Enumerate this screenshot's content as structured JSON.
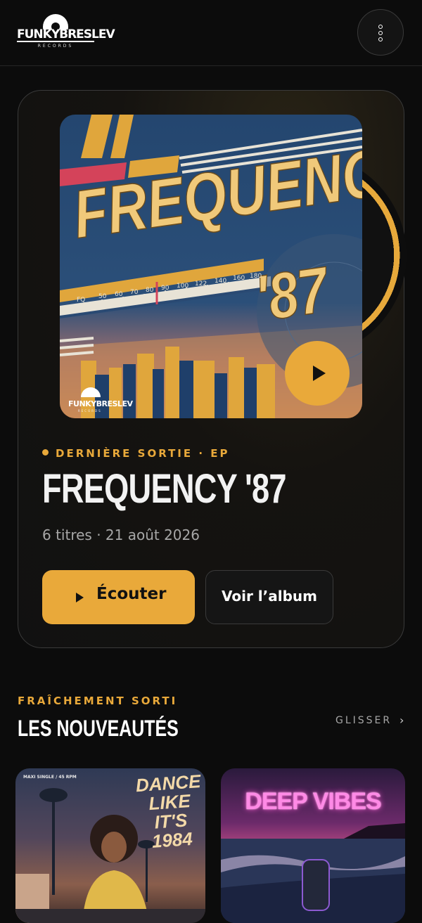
{
  "header": {
    "logo_text": "FUNKYBRESLEV",
    "logo_sub": "RECORDS"
  },
  "hero": {
    "cover_title": "FREQUENCY",
    "cover_year": "'87",
    "cover_dial_labels": [
      "FQ",
      "50",
      "60",
      "70",
      "80",
      "90",
      "100",
      "122",
      "140",
      "160",
      "180"
    ],
    "cover_logo": "FUNKYBRESLEV",
    "cover_logo_sub": "RECORDS",
    "eyebrow": "DERNIÈRE SORTIE · EP",
    "title": "FREQUENCY '87",
    "meta": "6 titres · 21 août 2026",
    "listen_label": "Écouter",
    "album_label": "Voir l’album"
  },
  "new_releases": {
    "eyebrow": "FRAÎCHEMENT SORTI",
    "title": "LES NOUVEAUTÉS",
    "swipe_label": "GLISSER",
    "swipe_icon": "chevron-right-icon",
    "items": [
      {
        "small": "MAXI SINGLE / 45 RPM",
        "title": "DANCE LIKE IT'S 1984"
      },
      {
        "title": "DEEP VIBES"
      }
    ]
  },
  "colors": {
    "accent": "#e9a93a",
    "background": "#0c0c0c",
    "card_border": "#3a3a3a",
    "muted_text": "#a7a7a7"
  }
}
